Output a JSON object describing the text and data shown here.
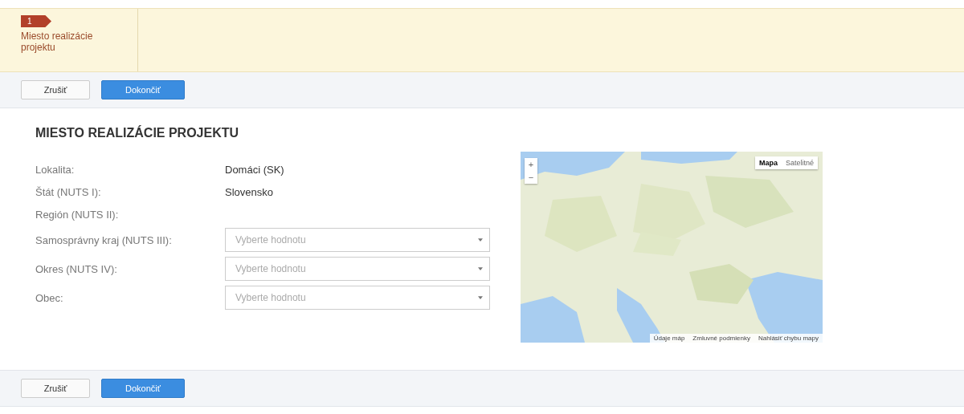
{
  "steps": [
    {
      "number": "1",
      "label": "Miesto realizácie projektu",
      "selected": true
    }
  ],
  "top_toolbar": [
    {
      "label": "Zrušiť",
      "kind": "secondary"
    },
    {
      "label": "Dokončiť",
      "kind": "primary"
    }
  ],
  "section_title": "MIESTO REALIZÁCIE PROJEKTU",
  "fields": [
    {
      "label": "Lokalita:",
      "kind": "text",
      "value": "Domáci (SK)"
    },
    {
      "label": "Štát (NUTS I):",
      "kind": "text",
      "value": "Slovensko"
    },
    {
      "label": "Región (NUTS II):",
      "kind": "text"
    },
    {
      "label": "Samosprávny kraj (NUTS III):",
      "kind": "select",
      "placeholder": "Vyberte hodnotu"
    },
    {
      "label": "Okres (NUTS IV):",
      "kind": "select",
      "placeholder": "Vyberte hodnotu"
    },
    {
      "label": "Obec:",
      "kind": "select",
      "placeholder": "Vyberte hodnotu"
    }
  ],
  "map": {
    "zoom_in": "+",
    "zoom_out": "−",
    "map_types": [
      {
        "label": "Mapa",
        "selected": true
      },
      {
        "label": "Satelitné",
        "selected": false
      }
    ],
    "footer_links": [
      "Údaje máp",
      "Zmluvné podmienky",
      "Nahlásiť chybu mapy"
    ]
  },
  "bottom_toolbar": [
    {
      "label": "Zrušiť",
      "kind": "secondary"
    },
    {
      "label": "Dokončiť",
      "kind": "primary"
    }
  ]
}
